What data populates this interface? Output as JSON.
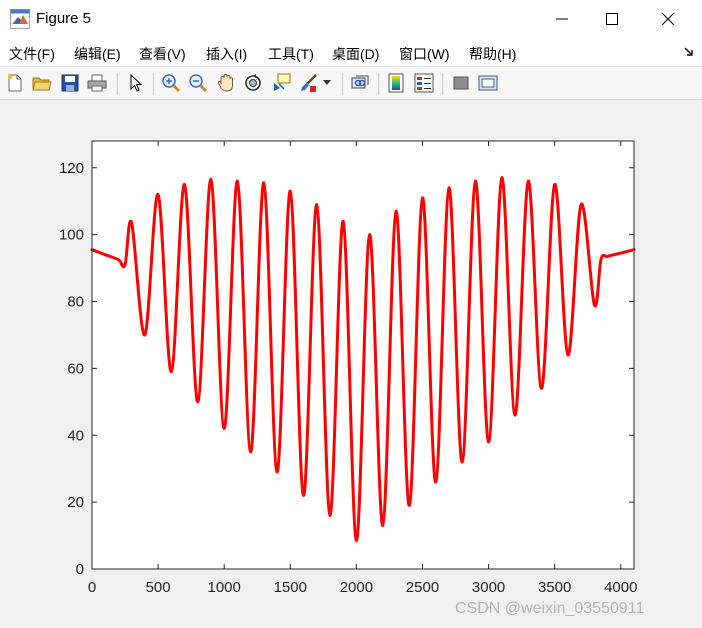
{
  "window": {
    "title": "Figure 5",
    "minimize_glyph": "—",
    "maximize_glyph": "☐",
    "close_glyph": "✕"
  },
  "menu": {
    "items": [
      {
        "label": "文件(F)"
      },
      {
        "label": "编辑(E)"
      },
      {
        "label": "查看(V)"
      },
      {
        "label": "插入(I)"
      },
      {
        "label": "工具(T)"
      },
      {
        "label": "桌面(D)"
      },
      {
        "label": "窗口(W)"
      },
      {
        "label": "帮助(H)"
      }
    ]
  },
  "toolbar": {
    "icons": [
      "new-figure-icon",
      "open-file-icon",
      "save-icon",
      "print-icon",
      "select-arrow-icon",
      "zoom-in-icon",
      "zoom-out-icon",
      "pan-hand-icon",
      "rotate-3d-icon",
      "data-cursor-icon",
      "brush-icon",
      "brush-dropdown-icon",
      "link-plot-icon",
      "colorbar-icon",
      "legend-icon",
      "hide-plot-tools-icon",
      "show-plot-tools-icon"
    ]
  },
  "colors": {
    "line": "#ff0000",
    "axes_bg": "#ffffff",
    "figure_bg": "#f0f0f0"
  },
  "chart_data": {
    "type": "line",
    "title": "",
    "xlabel": "",
    "ylabel": "",
    "xlim": [
      0,
      4100
    ],
    "ylim": [
      0,
      128
    ],
    "xticks": [
      0,
      500,
      1000,
      1500,
      2000,
      2500,
      3000,
      3500,
      4000
    ],
    "yticks": [
      0,
      20,
      40,
      60,
      80,
      100,
      120
    ],
    "grid": false,
    "series": [
      {
        "color": "#ff0000",
        "x": [
          0,
          100,
          200,
          250,
          300,
          400,
          500,
          600,
          700,
          800,
          900,
          1000,
          1100,
          1200,
          1300,
          1400,
          1500,
          1600,
          1700,
          1800,
          1900,
          2000,
          2100,
          2200,
          2300,
          2400,
          2500,
          2600,
          2700,
          2800,
          2900,
          3000,
          3100,
          3200,
          3300,
          3400,
          3500,
          3600,
          3700,
          3800,
          3850,
          3900,
          4000,
          4100
        ],
        "y": [
          95.5,
          94,
          92.5,
          91,
          103.5,
          70,
          112,
          59,
          115,
          50,
          116.5,
          42,
          116,
          35,
          115.5,
          29,
          113,
          22,
          109,
          16,
          104,
          8.5,
          100,
          13,
          107,
          19,
          111,
          26,
          114,
          32,
          116,
          38,
          117,
          46,
          116,
          54,
          115,
          64,
          109,
          79,
          92.5,
          93.5,
          94.5,
          95.5
        ]
      }
    ]
  },
  "watermark": "CSDN @weixin_03550911"
}
